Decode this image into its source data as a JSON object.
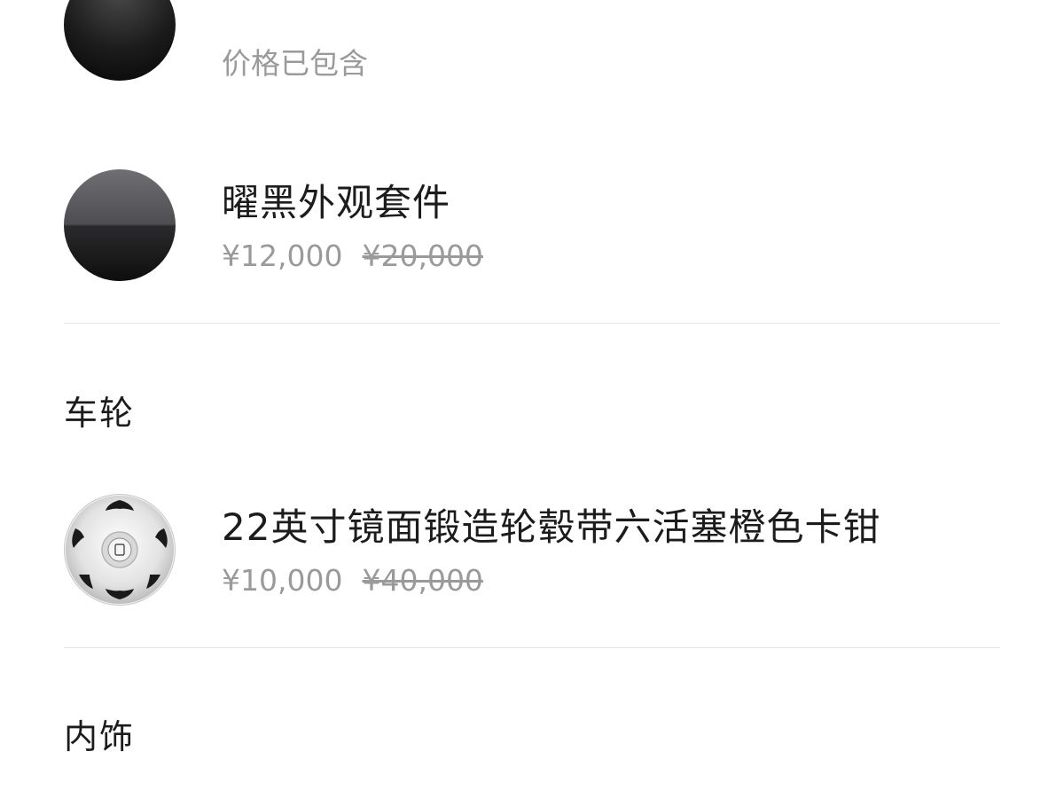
{
  "options": [
    {
      "subtitle": "价格已包含",
      "swatch": "black-paint-swatch",
      "color": "#1a1a1a"
    },
    {
      "title": "曜黑外观套件",
      "price": "¥12,000",
      "original_price": "¥20,000",
      "swatch": "obsidian-black-kit-swatch",
      "color": "#4e4e52"
    }
  ],
  "sections": [
    {
      "title": "车轮",
      "option": {
        "title": "22英寸镜面锻造轮毂带六活塞橙色卡钳",
        "price": "¥10,000",
        "original_price": "¥40,000",
        "icon": "wheel-rim-icon"
      }
    },
    {
      "title": "内饰"
    }
  ]
}
